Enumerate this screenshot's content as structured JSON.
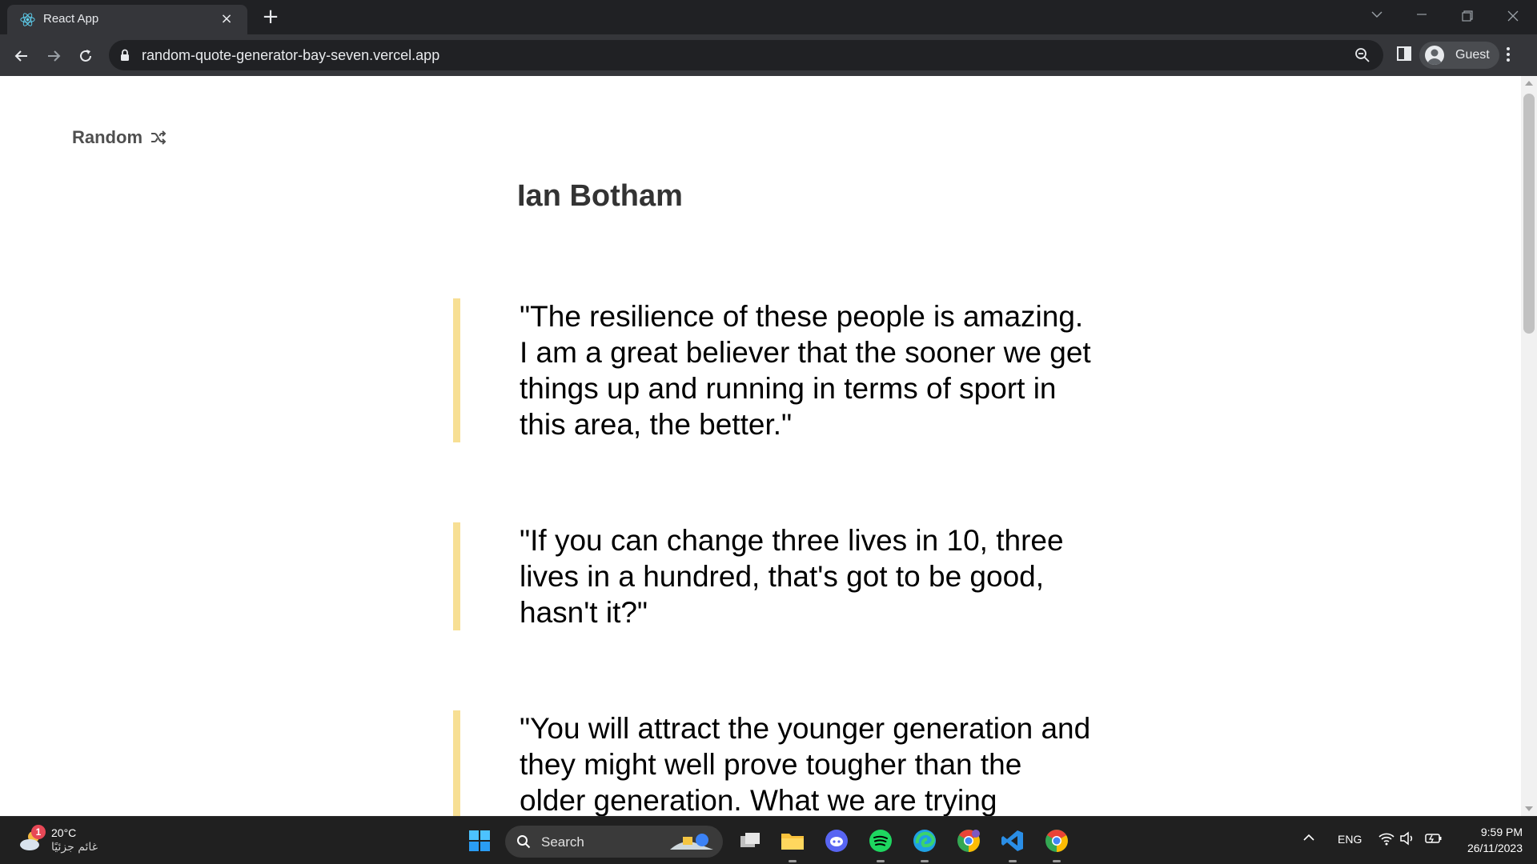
{
  "browser": {
    "tab": {
      "title": "React App",
      "icon": "react-icon"
    },
    "new_tab_icon": "plus-icon",
    "url": "random-quote-generator-bay-seven.vercel.app",
    "profile_label": "Guest"
  },
  "page": {
    "random_button": {
      "label": "Random",
      "icon": "shuffle-icon"
    },
    "author": "Ian Botham",
    "quotes": [
      "\"The resilience of these people is amazing. I am a great believer that the sooner we get things up and running in terms of sport in this area, the better.\"",
      "\"If you can change three lives in 10, three lives in a hundred, that's got to be good, hasn't it?\"",
      "\"You will attract the younger generation and they might well prove tougher than the older generation. What we are trying"
    ],
    "accent_color": "#f7df94"
  },
  "taskbar": {
    "weather": {
      "temp": "20°C",
      "condition": "غائم جزئيًا",
      "badge": "1"
    },
    "search_label": "Search",
    "apps": [
      "windows-start-icon",
      "task-view-icon",
      "file-explorer-icon",
      "discord-icon",
      "spotify-icon",
      "edge-icon",
      "chrome-profile-icon",
      "vscode-icon",
      "chrome-icon"
    ],
    "language": "ENG",
    "time": "9:59 PM",
    "date": "26/11/2023"
  }
}
